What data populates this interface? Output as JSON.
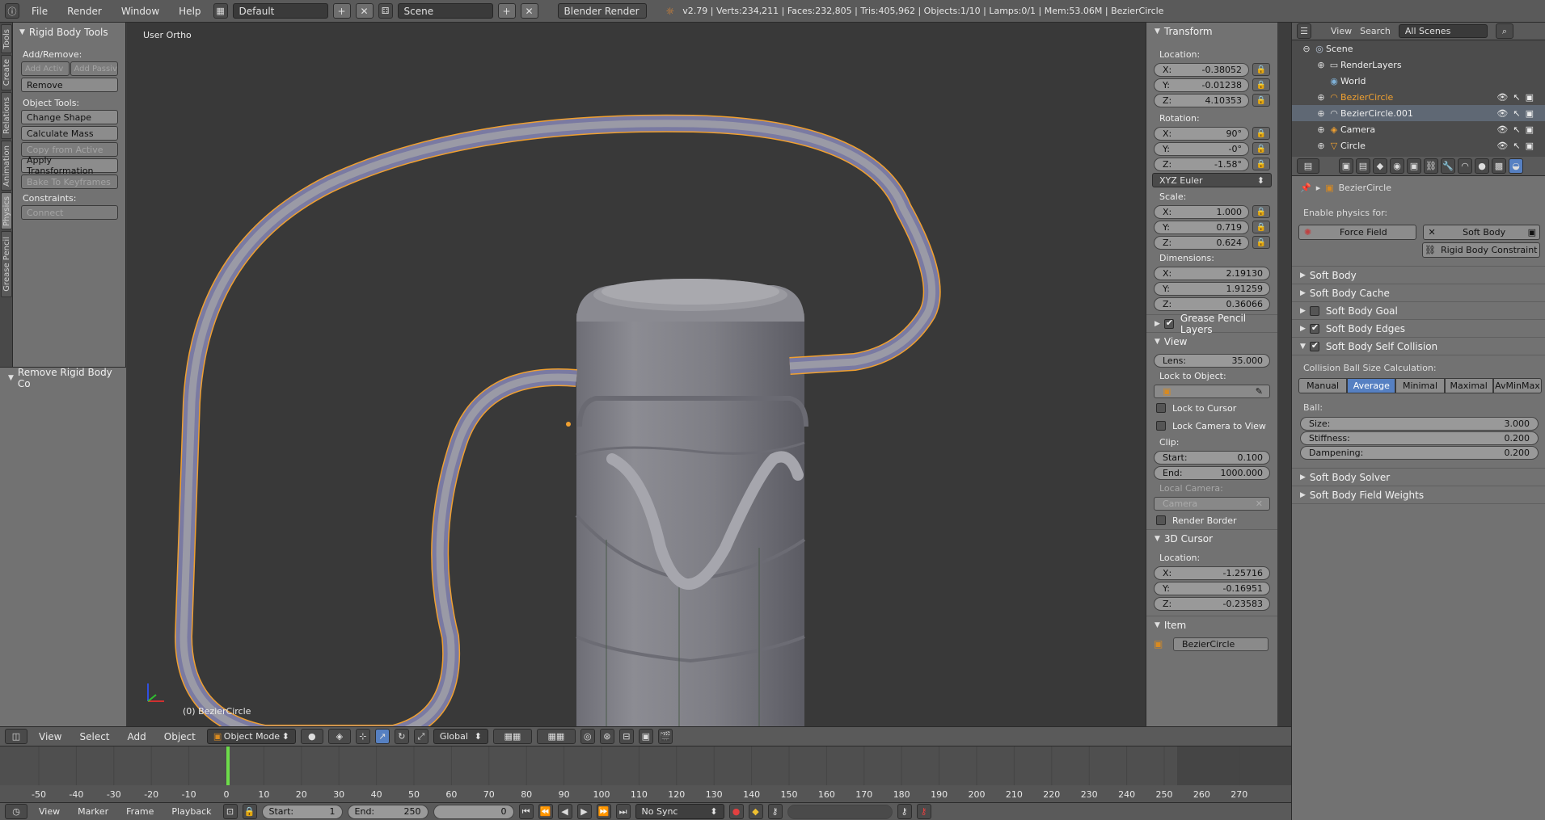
{
  "topbar": {
    "menus": [
      "File",
      "Render",
      "Window",
      "Help"
    ],
    "layout": "Default",
    "scene": "Scene",
    "engine": "Blender Render",
    "stats": "v2.79 | Verts:234,211 | Faces:232,805 | Tris:405,962 | Objects:1/10 | Lamps:0/1 | Mem:53.06M | BezierCircle"
  },
  "vtabs": [
    "Tools",
    "Create",
    "Relations",
    "Animation",
    "Physics",
    "Grease Pencil"
  ],
  "toolshelf": {
    "title": "Rigid Body Tools",
    "add_remove_label": "Add/Remove:",
    "add_active": "Add Activ",
    "add_passive": "Add Passiv",
    "remove": "Remove",
    "object_tools_label": "Object Tools:",
    "change_shape": "Change Shape",
    "calculate_mass": "Calculate Mass",
    "copy_from_active": "Copy from Active",
    "apply_transformation": "Apply Transformation",
    "bake_to_keyframes": "Bake To Keyframes",
    "constraints_label": "Constraints:",
    "connect": "Connect",
    "last_op": "Remove Rigid Body Co"
  },
  "viewport": {
    "view_label": "User Ortho",
    "object_label": "(0) BezierCircle"
  },
  "npanel": {
    "transform_title": "Transform",
    "location_label": "Location:",
    "location": {
      "x": "-0.38052",
      "y": "-0.01238",
      "z": "4.10353"
    },
    "rotation_label": "Rotation:",
    "rotation": {
      "x": "90°",
      "y": "-0°",
      "z": "-1.58°"
    },
    "rotation_mode": "XYZ Euler",
    "scale_label": "Scale:",
    "scale": {
      "x": "1.000",
      "y": "0.719",
      "z": "0.624"
    },
    "dimensions_label": "Dimensions:",
    "dimensions": {
      "x": "2.19130",
      "y": "1.91259",
      "z": "0.36066"
    },
    "grease_pencil_layers": "Grease Pencil Layers",
    "view_title": "View",
    "lens_label": "Lens:",
    "lens": "35.000",
    "lock_to_object": "Lock to Object:",
    "lock_to_cursor": "Lock to Cursor",
    "lock_camera": "Lock Camera to View",
    "clip_label": "Clip:",
    "clip_start_label": "Start:",
    "clip_start": "0.100",
    "clip_end_label": "End:",
    "clip_end": "1000.000",
    "local_camera": "Local Camera:",
    "camera": "Camera",
    "render_border": "Render Border",
    "cursor_title": "3D Cursor",
    "cursor_location_label": "Location:",
    "cursor": {
      "x": "-1.25716",
      "y": "-0.16951",
      "z": "-0.23583"
    },
    "item_title": "Item",
    "item_name": "BezierCircle",
    "axis": {
      "x": "X:",
      "y": "Y:",
      "z": "Z:"
    }
  },
  "outliner": {
    "menus": [
      "View",
      "Search"
    ],
    "filter": "All Scenes",
    "items": [
      "Scene",
      "RenderLayers",
      "World",
      "BezierCircle",
      "BezierCircle.001",
      "Camera",
      "Circle"
    ]
  },
  "properties": {
    "object_name": "BezierCircle",
    "enable_physics": "Enable physics for:",
    "force_field": "Force Field",
    "soft_body": "Soft Body",
    "rigid_body_constraint": "Rigid Body Constraint",
    "sections": [
      "Soft Body",
      "Soft Body Cache",
      "Soft Body Goal",
      "Soft Body Edges",
      "Soft Body Self Collision"
    ],
    "collision_calc_label": "Collision Ball Size Calculation:",
    "calc_modes": [
      "Manual",
      "Average",
      "Minimal",
      "Maximal",
      "AvMinMax"
    ],
    "calc_selected": "Average",
    "ball_label": "Ball:",
    "size_label": "Size:",
    "size": "3.000",
    "stiffness_label": "Stiffness:",
    "stiffness": "0.200",
    "dampening_label": "Dampening:",
    "dampening": "0.200",
    "solver": "Soft Body Solver",
    "field_weights": "Soft Body Field Weights"
  },
  "view_header": {
    "menus": [
      "View",
      "Select",
      "Add",
      "Object"
    ],
    "mode": "Object Mode",
    "orientation": "Global"
  },
  "timeline": {
    "ticks": [
      "-50",
      "-40",
      "-30",
      "-20",
      "-10",
      "0",
      "10",
      "20",
      "30",
      "40",
      "50",
      "60",
      "70",
      "80",
      "90",
      "100",
      "110",
      "120",
      "130",
      "140",
      "150",
      "160",
      "170",
      "180",
      "190",
      "200",
      "210",
      "220",
      "230",
      "240",
      "250",
      "260",
      "270"
    ],
    "current_frame_marker": 0,
    "menus": [
      "View",
      "Marker",
      "Frame",
      "Playback"
    ],
    "start_label": "Start:",
    "start": "1",
    "end_label": "End:",
    "end": "250",
    "current": "0",
    "sync": "No Sync"
  }
}
